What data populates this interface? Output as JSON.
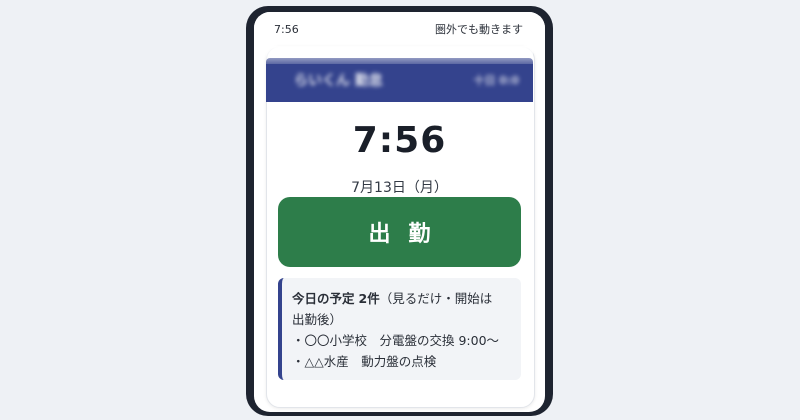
{
  "status_bar": {
    "time": "7:56",
    "offline_notice": "圏外でも動きます"
  },
  "app_header": {
    "title": "らいくん 勤怠",
    "right_text": "十日 0:0"
  },
  "clock": {
    "time": "7:56",
    "date": "7月13日（月）"
  },
  "clock_in_button": {
    "label": "出勤"
  },
  "schedule": {
    "title": "今日の予定",
    "count": "2件",
    "note_line1": "（見るだけ・開始は",
    "note_line2": "出勤後）",
    "items": [
      "・〇〇小学校　分電盤の交換 9:00〜",
      "・△△水産　動力盤の点検"
    ]
  },
  "colors": {
    "header": "#34438d",
    "clock_in_button": "#2d7d4a",
    "panel_bg": "#f2f4f7",
    "frame": "#1e2430"
  }
}
